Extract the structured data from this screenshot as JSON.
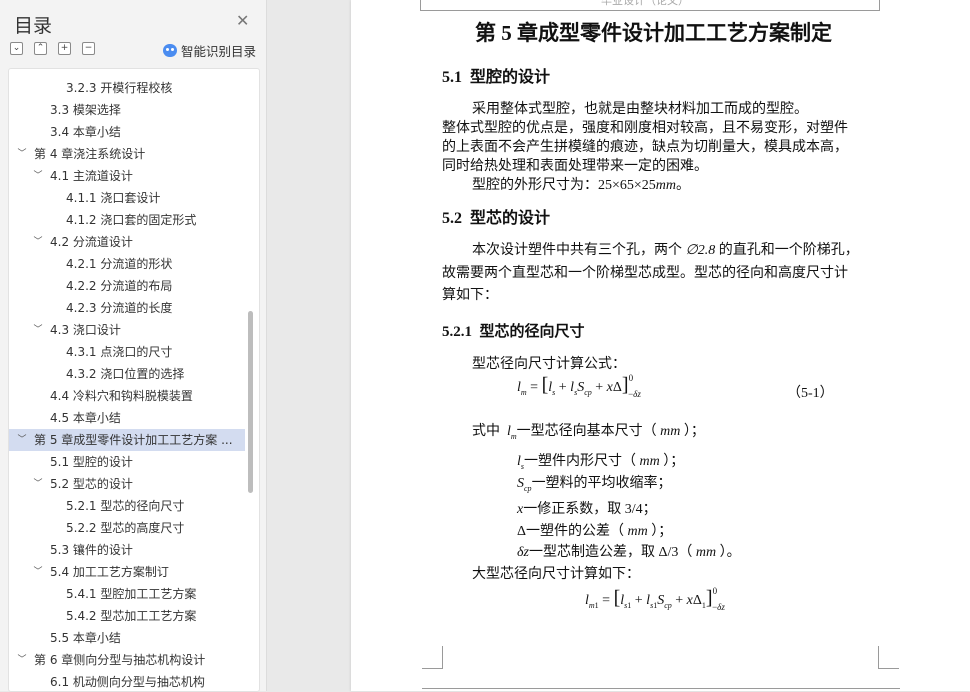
{
  "toc": {
    "title": "目录",
    "smart_label": "智能识别目录",
    "toolbar": {
      "collapse": "⌄",
      "expand": "⌃",
      "add": "+",
      "remove": "−"
    },
    "items": [
      {
        "level": 3,
        "label": "3.2.3  开模行程校核"
      },
      {
        "level": 2,
        "label": "3.3  模架选择"
      },
      {
        "level": 2,
        "label": "3.4  本章小结"
      },
      {
        "level": 1,
        "label": "第 4 章浇注系统设计",
        "expanded": true
      },
      {
        "level": 2,
        "label": "4.1  主流道设计",
        "expanded": true
      },
      {
        "level": 3,
        "label": "4.1.1  浇口套设计"
      },
      {
        "level": 3,
        "label": "4.1.2  浇口套的固定形式"
      },
      {
        "level": 2,
        "label": "4.2  分流道设计",
        "expanded": true
      },
      {
        "level": 3,
        "label": "4.2.1  分流道的形状"
      },
      {
        "level": 3,
        "label": "4.2.2  分流道的布局"
      },
      {
        "level": 3,
        "label": "4.2.3  分流道的长度"
      },
      {
        "level": 2,
        "label": "4.3  浇口设计",
        "expanded": true
      },
      {
        "level": 3,
        "label": "4.3.1  点浇口的尺寸"
      },
      {
        "level": 3,
        "label": "4.3.2  浇口位置的选择"
      },
      {
        "level": 2,
        "label": "4.4  冷料穴和钩料脱模装置"
      },
      {
        "level": 2,
        "label": "4.5  本章小结"
      },
      {
        "level": 1,
        "label": "第 5 章成型零件设计加工工艺方案 ...",
        "expanded": true,
        "selected": true
      },
      {
        "level": 2,
        "label": "5.1  型腔的设计"
      },
      {
        "level": 2,
        "label": "5.2  型芯的设计",
        "expanded": true
      },
      {
        "level": 3,
        "label": "5.2.1  型芯的径向尺寸"
      },
      {
        "level": 3,
        "label": "5.2.2  型芯的高度尺寸"
      },
      {
        "level": 2,
        "label": "5.3  镶件的设计"
      },
      {
        "level": 2,
        "label": "5.4  加工工艺方案制订",
        "expanded": true
      },
      {
        "level": 3,
        "label": "5.4.1  型腔加工工艺方案"
      },
      {
        "level": 3,
        "label": "5.4.2  型芯加工工艺方案"
      },
      {
        "level": 2,
        "label": "5.5  本章小结"
      },
      {
        "level": 1,
        "label": "第 6 章侧向分型与抽芯机构设计",
        "expanded": true
      },
      {
        "level": 2,
        "label": "6.1  机动侧向分型与抽芯机构"
      }
    ]
  },
  "document": {
    "header_text": "毕业设计（论文）",
    "chapter_title": "第 5 章成型零件设计加工工艺方案制定",
    "s51": {
      "num": "5.1",
      "title": "型腔的设计"
    },
    "p1": "采用整体式型腔，也就是由整块材料加工而成的型腔。",
    "p2": "整体式型腔的优点是，强度和刚度相对较高，且不易变形，对塑件",
    "p3": "的上表面不会产生拼模缝的痕迹，缺点为切削量大，模具成本高，",
    "p4": "同时给热处理和表面处理带来一定的困难。",
    "p5_text": "型腔的外形尺寸为：",
    "p5_dims": "25×65×25",
    "p5_unit": "mm",
    "p5_end": "。",
    "s52": {
      "num": "5.2",
      "title": "型芯的设计"
    },
    "p6a": "本次设计塑件中共有三个孔，两个 ",
    "p6dia": "∅2.8",
    "p6b": " 的直孔和一个阶梯孔，",
    "p7": "故需要两个直型芯和一个阶梯型芯成型。型芯的径向和高度尺寸计",
    "p8": "算如下：",
    "s521": {
      "num": "5.2.1",
      "title": "型芯的径向尺寸"
    },
    "formula_intro": "型芯径向尺寸计算公式：",
    "formula_num": "（5-1）",
    "where_label": "式中",
    "def_lm": "一型芯径向基本尺寸（",
    "def_ls": "一塑件内形尺寸（",
    "def_scp": "一塑料的平均收缩率；",
    "def_x": "一修正系数，取 3/4；",
    "def_delta": "一塑件的公差（",
    "def_dz_a": "一型芯制造公差，取",
    "def_dz_b": "Δ/3（",
    "unit_mm": "mm",
    "close_paren": "）；",
    "close_end": "）。",
    "large_intro": "大型芯径向尺寸计算如下："
  }
}
